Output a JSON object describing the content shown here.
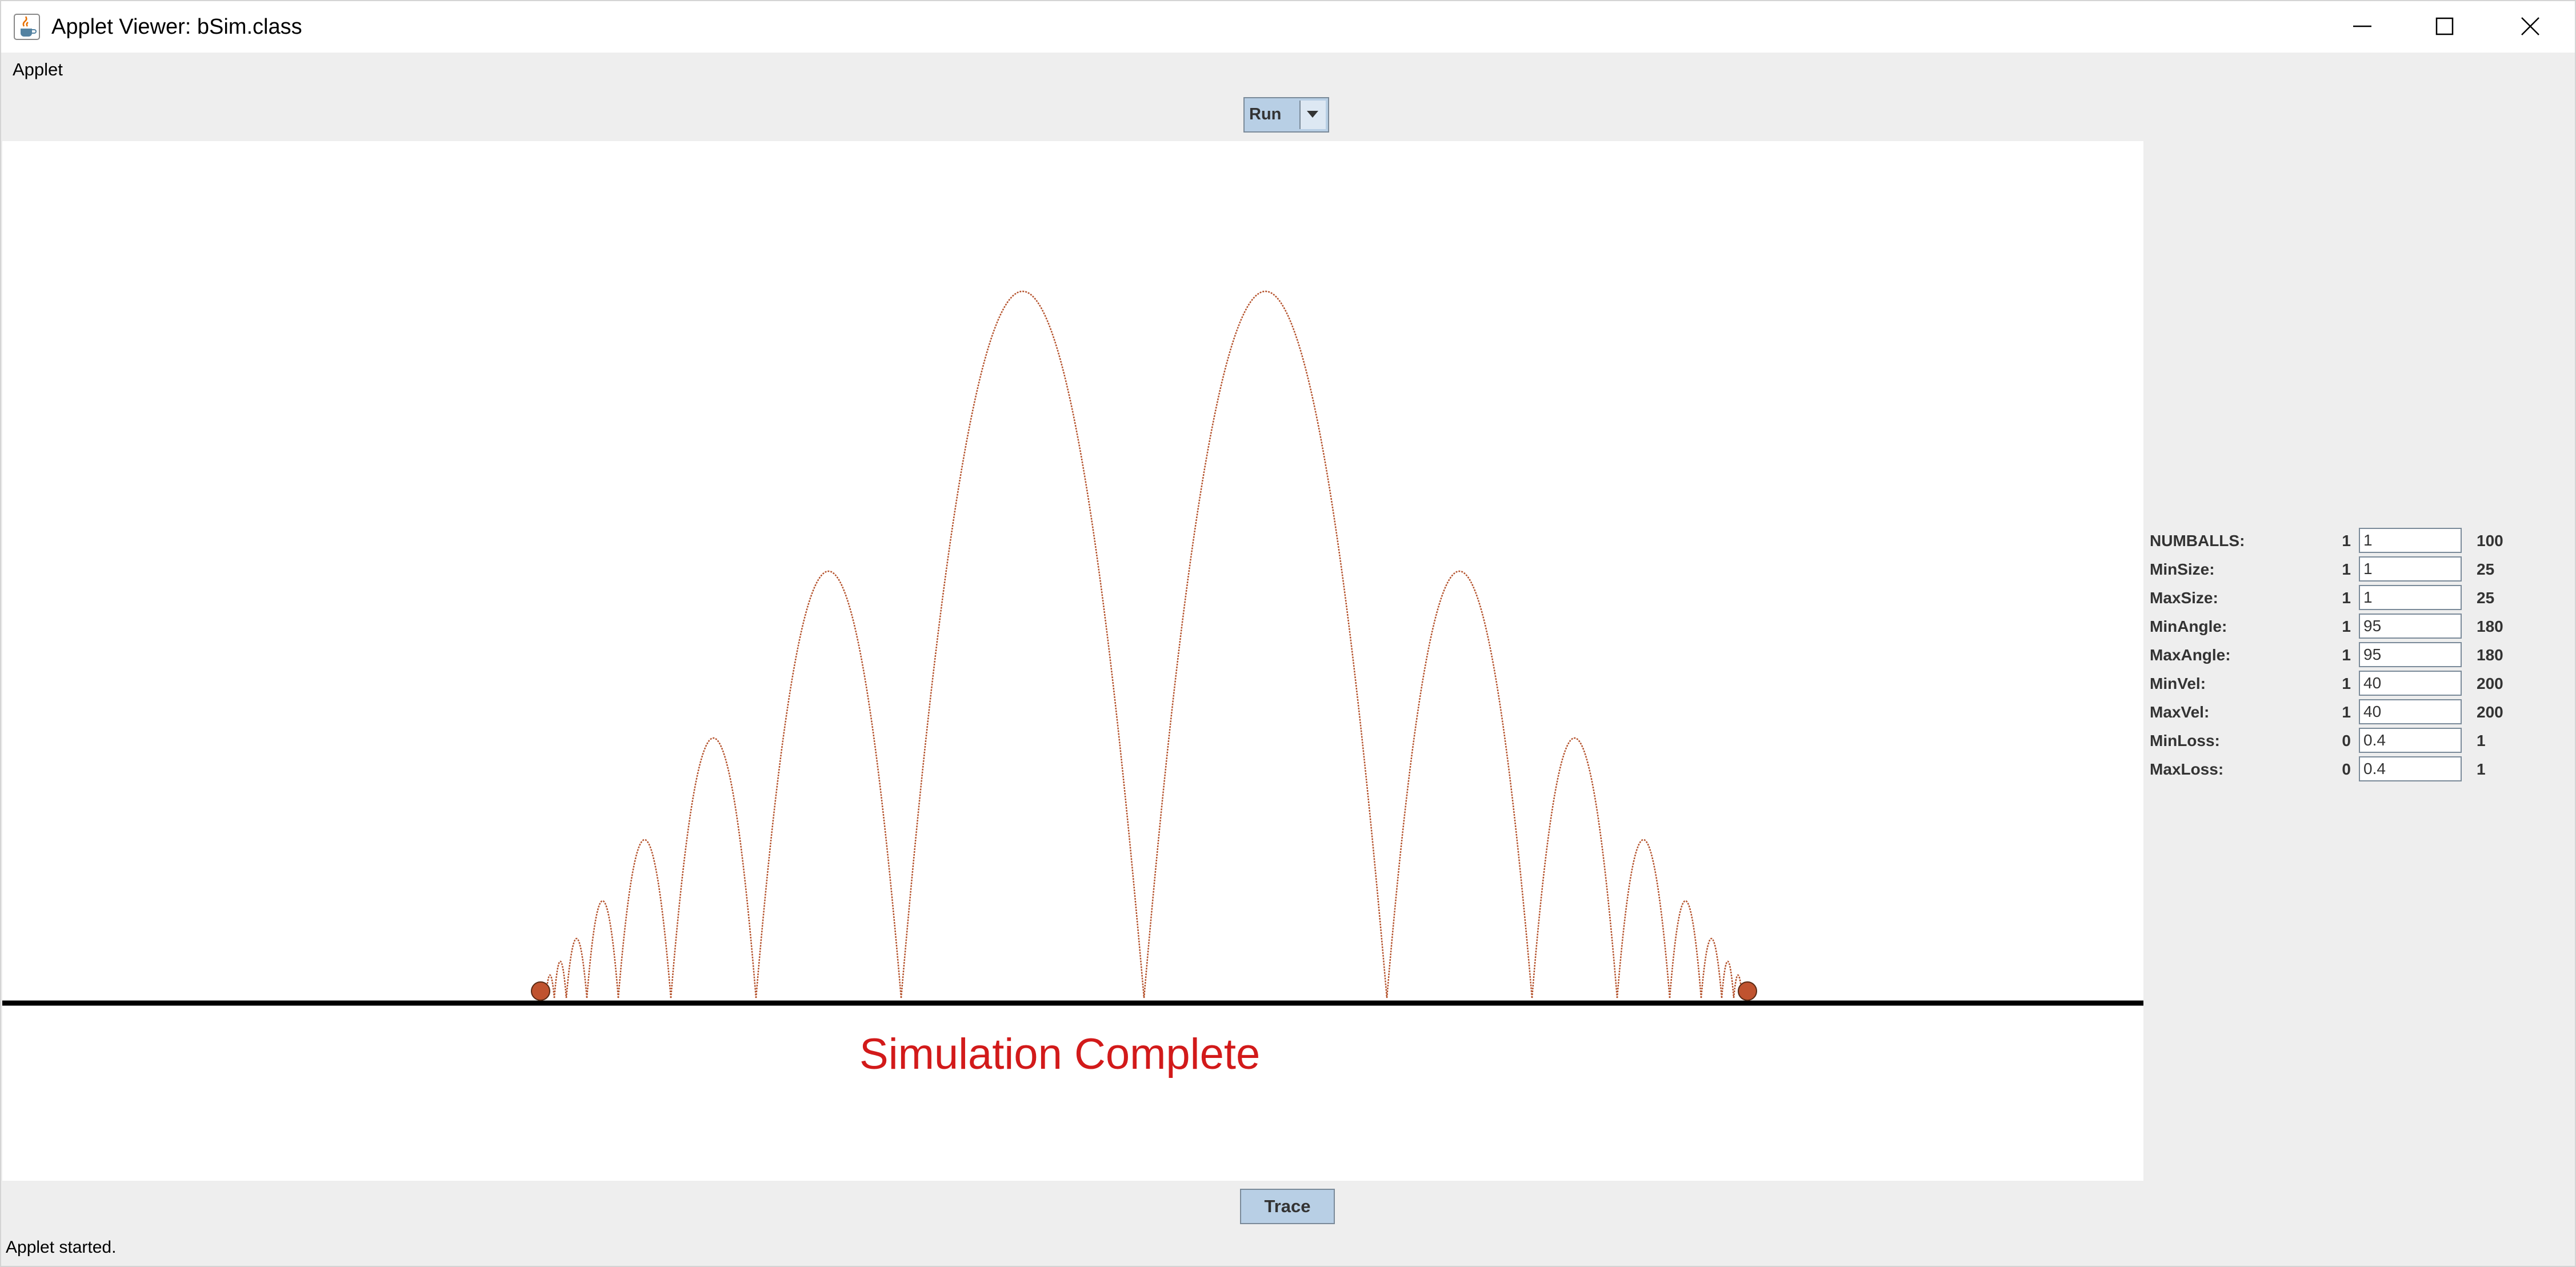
{
  "window": {
    "title": "Applet Viewer: bSim.class",
    "icon": "java-cup-icon"
  },
  "menubar": {
    "items": [
      "Applet"
    ]
  },
  "toolbar": {
    "run_combo_value": "Run"
  },
  "simulation": {
    "message": "Simulation Complete",
    "message_color": "#d21a1a",
    "trace_color": "#b5532d",
    "ball_color": "#c0532f"
  },
  "params": [
    {
      "label": "NUMBALLS:",
      "min": "1",
      "value": "1",
      "max": "100"
    },
    {
      "label": "MinSize:",
      "min": "1",
      "value": "1",
      "max": "25"
    },
    {
      "label": "MaxSize:",
      "min": "1",
      "value": "1",
      "max": "25"
    },
    {
      "label": "MinAngle:",
      "min": "1",
      "value": "95",
      "max": "180"
    },
    {
      "label": "MaxAngle:",
      "min": "1",
      "value": "95",
      "max": "180"
    },
    {
      "label": "MinVel:",
      "min": "1",
      "value": "40",
      "max": "200"
    },
    {
      "label": "MaxVel:",
      "min": "1",
      "value": "40",
      "max": "200"
    },
    {
      "label": "MinLoss:",
      "min": "0",
      "value": "0.4",
      "max": "1"
    },
    {
      "label": "MaxLoss:",
      "min": "0",
      "value": "0.4",
      "max": "1"
    }
  ],
  "bottom": {
    "trace_label": "Trace"
  },
  "status": {
    "text": "Applet started."
  }
}
